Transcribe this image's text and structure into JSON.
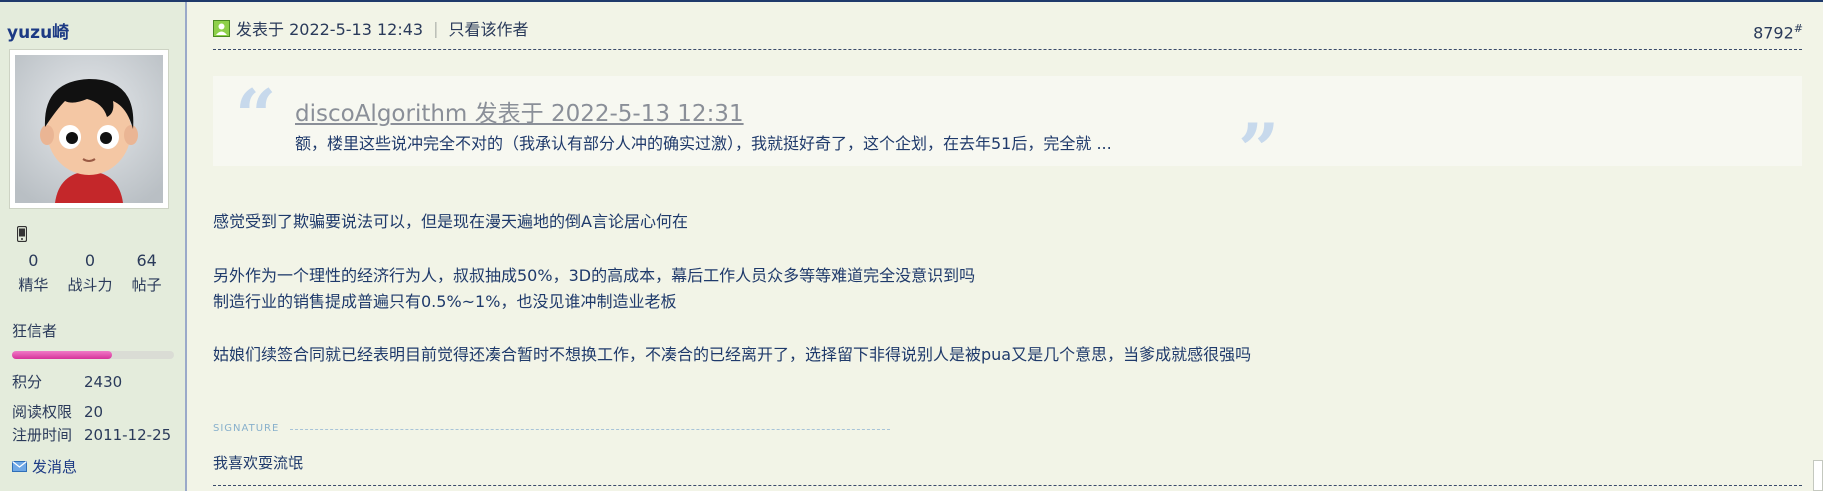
{
  "author": {
    "username": "yuzu崎",
    "stats": [
      {
        "value": "0",
        "label": "精华"
      },
      {
        "value": "0",
        "label": "战斗力"
      },
      {
        "value": "64",
        "label": "帖子"
      }
    ],
    "rank": "狂信者",
    "rank_progress": 0.62,
    "info": [
      {
        "key": "积分",
        "value": "2430"
      },
      {
        "key": "阅读权限",
        "value": "20"
      },
      {
        "key": "注册时间",
        "value": "2011-12-25"
      }
    ],
    "send_message_label": "发消息"
  },
  "post": {
    "posted_at": "发表于 2022-5-13 12:43",
    "only_author_link": "只看该作者",
    "separator": "|",
    "floor_number": "8792",
    "floor_suffix": "#",
    "quote": {
      "title": "discoAlgorithm 发表于 2022-5-13 12:31",
      "text": "额，楼里这些说冲完全不对的（我承认有部分人冲的确实过激），我就挺好奇了，这个企划，在去年51后，完全就 ..."
    },
    "body_lines": [
      "感觉受到了欺骗要说法可以，但是现在漫天遍地的倒A言论居心何在",
      "另外作为一个理性的经济行为人，叔叔抽成50%，3D的高成本，幕后工作人员众多等等难道完全没意识到吗",
      "制造行业的销售提成普遍只有0.5%~1%，也没见谁冲制造业老板",
      "姑娘们续签合同就已经表明目前觉得还凑合暂时不想换工作，不凑合的已经离开了，选择留下非得说别人是被pua又是几个意思，当爹成就感很强吗"
    ],
    "signature_label": "SIGNATURE",
    "signature_text": "我喜欢耍流氓"
  },
  "icons": {
    "phone": "phone-icon",
    "user": "user-icon",
    "mail": "mail-icon",
    "quote_open": "“",
    "quote_close": "”"
  },
  "colors": {
    "text": "#1f3a6b",
    "username": "#1c3a84",
    "rank_bar": "#d6339a",
    "quote_mark": "#c7d9ec"
  }
}
